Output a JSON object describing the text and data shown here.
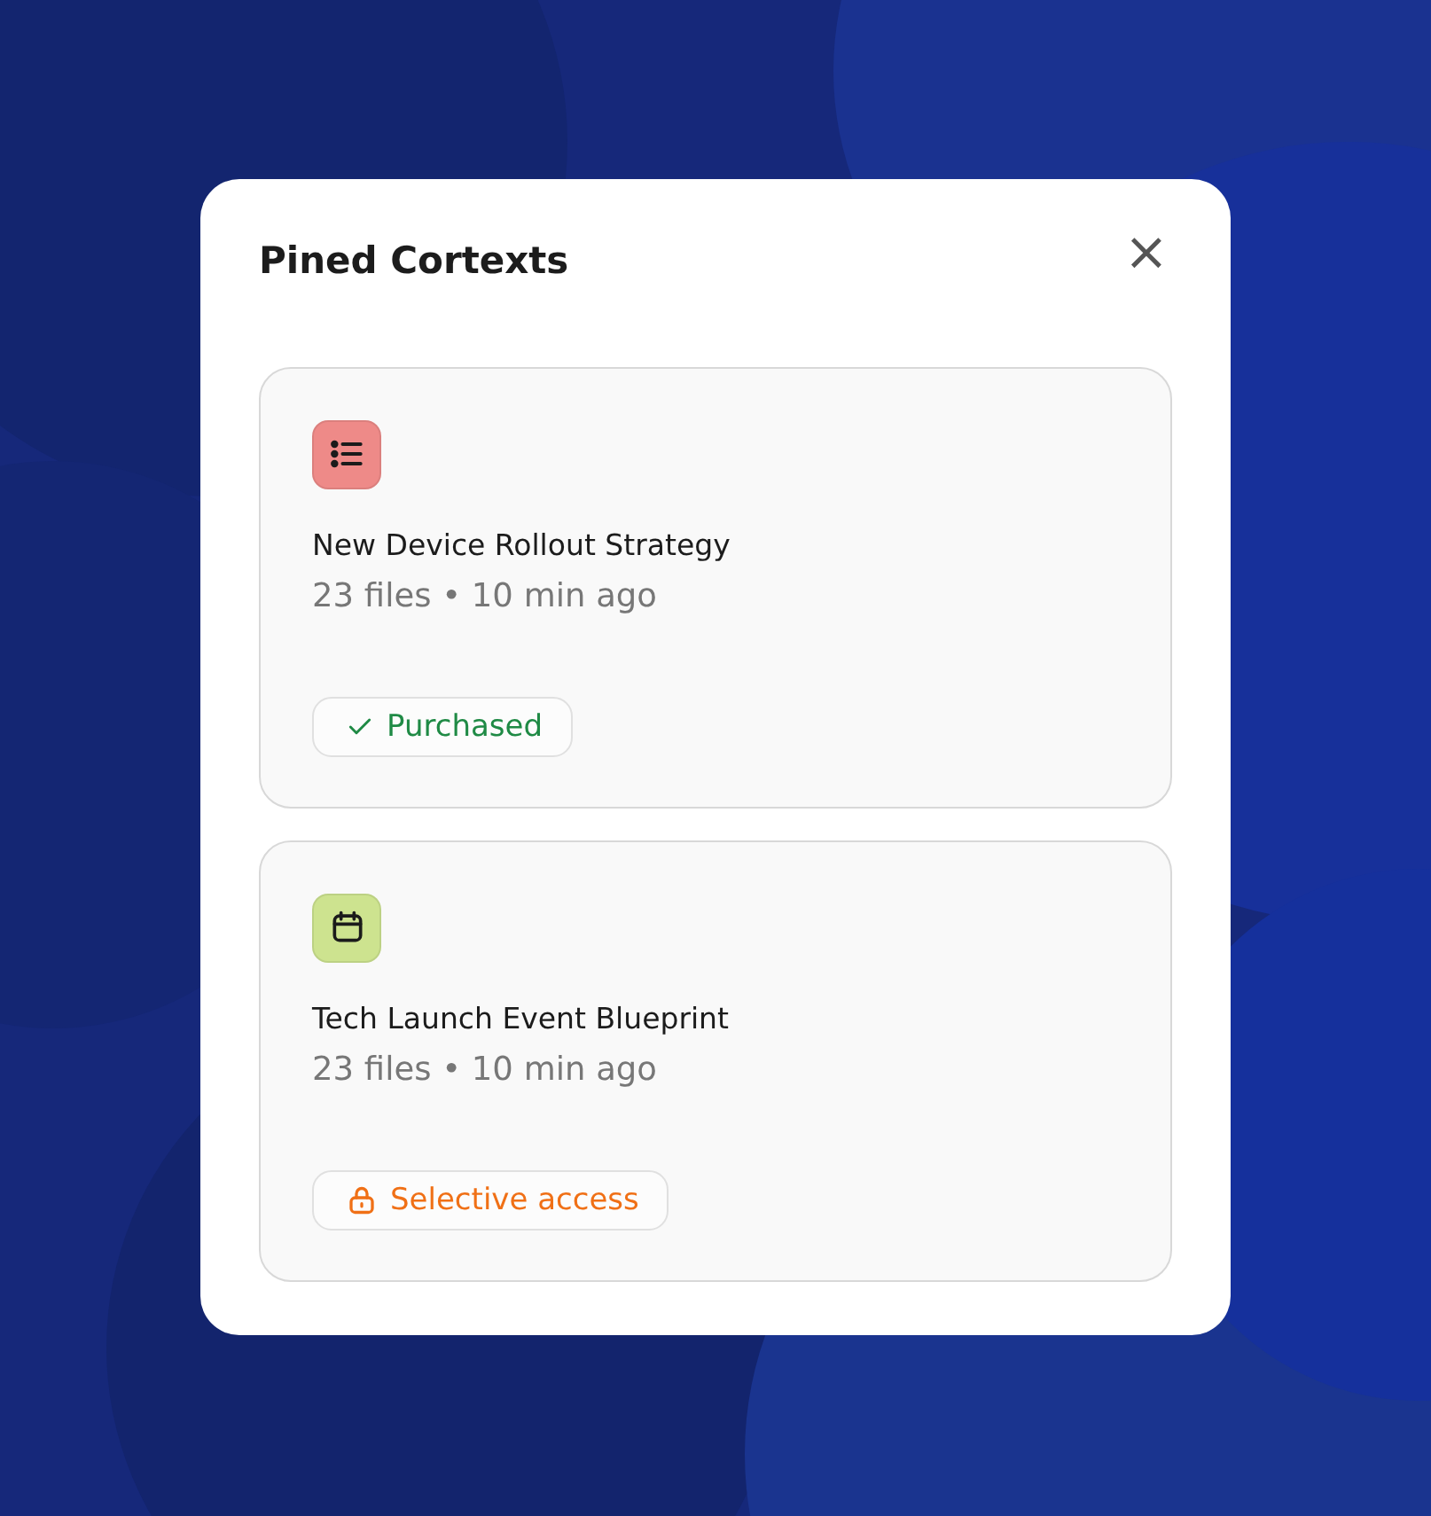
{
  "dialog": {
    "title": "Pined Cortexts",
    "close": "×"
  },
  "contexts": [
    {
      "kind": "list",
      "color": "#ee8a88",
      "name": "New Device Rollout Strategy",
      "meta": "23 files • 10 min ago",
      "status": {
        "kind": "purchased",
        "label": "Purchased",
        "color": "#1f8a45"
      }
    },
    {
      "kind": "calendar",
      "color": "#cde38f",
      "name": "Tech Launch Event Blueprint",
      "meta": "23 files • 10 min ago",
      "status": {
        "kind": "locked",
        "label": "Selective access",
        "color": "#f07016"
      }
    }
  ]
}
